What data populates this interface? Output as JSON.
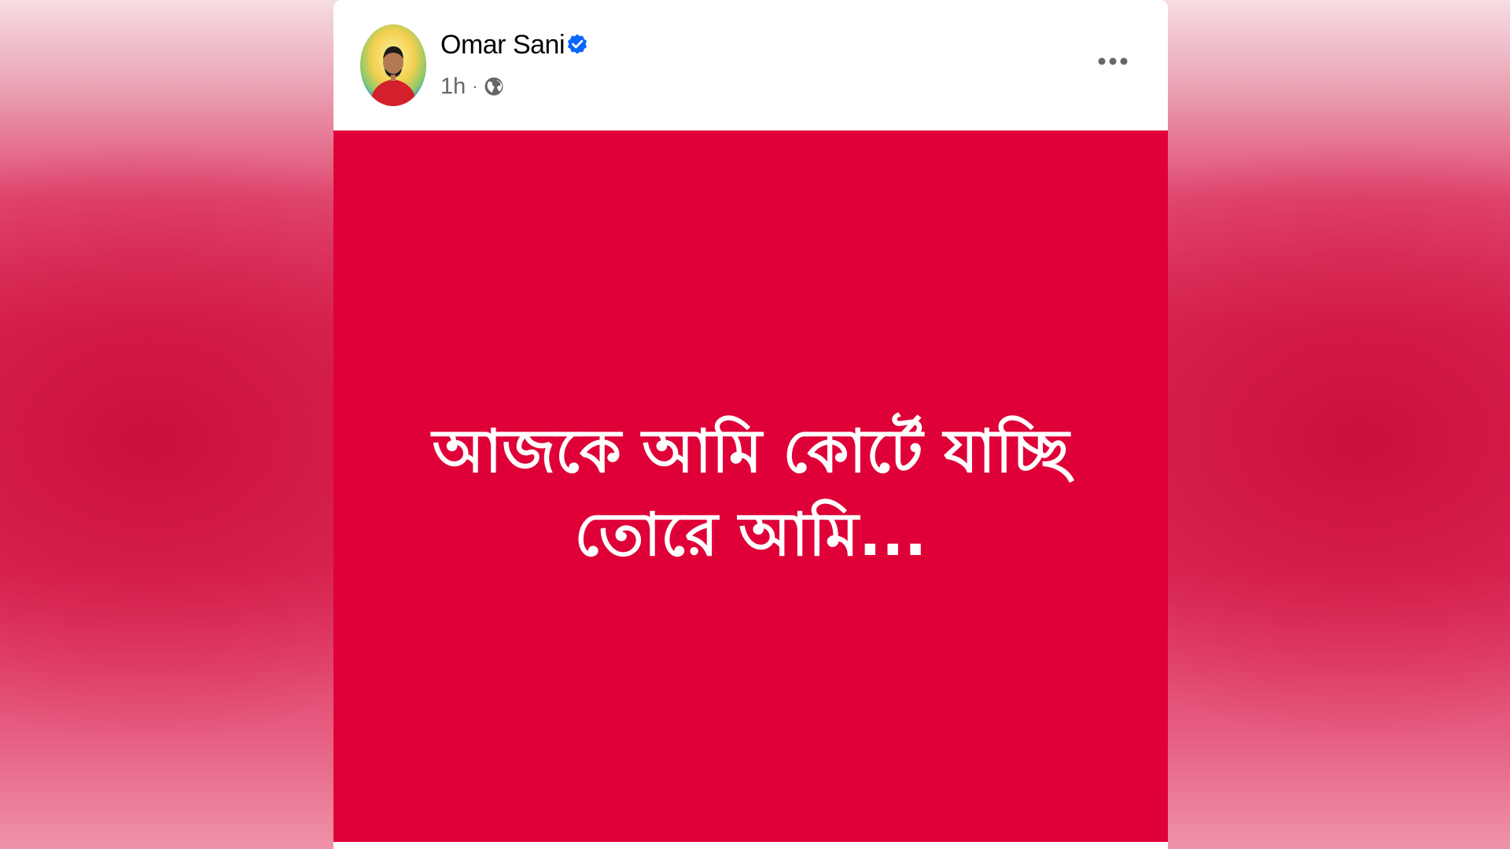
{
  "post": {
    "author": {
      "name": "Omar Sani",
      "verified": true,
      "avatar_icon": "profile-photo"
    },
    "meta": {
      "time": "1h",
      "separator": "·",
      "audience_icon": "globe-icon"
    },
    "menu_icon": "more-options-icon",
    "body": {
      "background_color": "#df0038",
      "text_color": "#ffffff",
      "lines": [
        "আজকে আমি কোর্টে যাচ্ছি",
        "তোরে আমি..."
      ]
    }
  },
  "colors": {
    "verified_badge": "#0866ff",
    "meta_text": "#65676b",
    "author_text": "#050505"
  }
}
